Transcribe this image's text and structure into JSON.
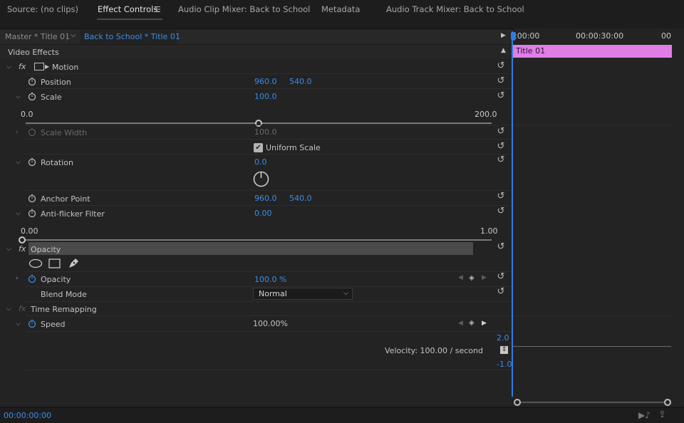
{
  "tabs": [
    {
      "label": "Source: (no clips)"
    },
    {
      "label": "Effect Controls"
    },
    {
      "label": "Audio Clip Mixer: Back to School"
    },
    {
      "label": "Metadata"
    },
    {
      "label": "Audio Track Mixer: Back to School"
    }
  ],
  "header": {
    "master_label": "Master * Title 01",
    "sequence_label": "Back to School * Title 01"
  },
  "timeline": {
    "tick_start": ":00:00",
    "tick_mid": "00:00:30:00",
    "tick_end": "00",
    "clip_label": "Title 01"
  },
  "sections": {
    "video_effects": "Video Effects",
    "motion": "Motion",
    "opacity": "Opacity",
    "time_remapping": "Time Remapping"
  },
  "fx_label": "fx",
  "motion": {
    "position_label": "Position",
    "position_x": "960.0",
    "position_y": "540.0",
    "scale_label": "Scale",
    "scale_value": "100.0",
    "scale_min": "0.0",
    "scale_max": "200.0",
    "scale_slider_level": 0.5,
    "scale_width_label": "Scale Width",
    "scale_width_value": "100.0",
    "uniform_scale_label": "Uniform Scale",
    "uniform_scale_checked": true,
    "rotation_label": "Rotation",
    "rotation_value": "0.0",
    "anchor_label": "Anchor Point",
    "anchor_x": "960.0",
    "anchor_y": "540.0",
    "antiflicker_label": "Anti-flicker Filter",
    "antiflicker_value": "0.00",
    "antiflicker_min": "0.00",
    "antiflicker_max": "1.00",
    "antiflicker_slider_level": 0.0
  },
  "opacity": {
    "opacity_label": "Opacity",
    "opacity_value": "100.0 %",
    "blend_label": "Blend Mode",
    "blend_value": "Normal"
  },
  "time_remap": {
    "speed_label": "Speed",
    "speed_value": "100.00%",
    "graph_max": "2.0",
    "graph_min": "-1.0",
    "velocity": "Velocity: 100.00 / second"
  },
  "status": {
    "timecode": "00:00:00:00"
  },
  "colors": {
    "accent": "#3a8ee6",
    "clip": "#e07ee6",
    "playhead": "#2f7de0"
  }
}
